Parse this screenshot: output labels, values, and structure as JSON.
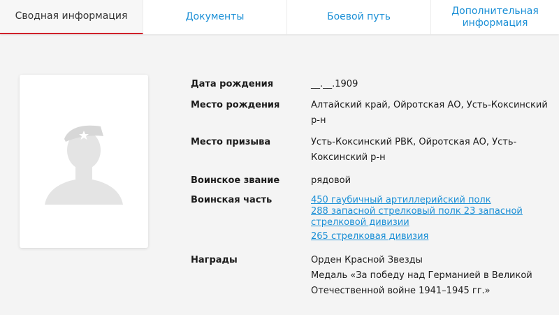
{
  "tabs": [
    {
      "label": "Сводная информация",
      "active": true
    },
    {
      "label": "Документы",
      "active": false
    },
    {
      "label": "Боевой путь",
      "active": false
    },
    {
      "label": "Дополнительная информация",
      "active": false
    }
  ],
  "photo": {
    "icon": "soldier-silhouette-icon"
  },
  "info": {
    "birth_date": {
      "label": "Дата рождения",
      "value": "__.__.1909"
    },
    "birth_place": {
      "label": "Место рождения",
      "value": "Алтайский край, Ойротская АО, Усть-Коксинский р-н"
    },
    "draft_place": {
      "label": "Место призыва",
      "value": "Усть-Коксинский РВК, Ойротская АО, Усть-Коксинский р-н"
    },
    "rank": {
      "label": "Воинское звание",
      "value": "рядовой"
    },
    "unit": {
      "label": "Воинская часть",
      "links": [
        "450 гаубичный артиллерийский полк",
        "288 запасной стрелковый полк 23 запасной стрелковой дивизии",
        "265 стрелковая дивизия"
      ]
    },
    "awards": {
      "label": "Награды",
      "items": [
        "Орден Красной Звезды",
        "Медаль «За победу над Германией в Великой Отечественной войне 1941–1945 гг.»"
      ]
    }
  },
  "colors": {
    "link": "#1a8fd6",
    "active_underline": "#d0202a",
    "placeholder": "#e6e6e6"
  }
}
